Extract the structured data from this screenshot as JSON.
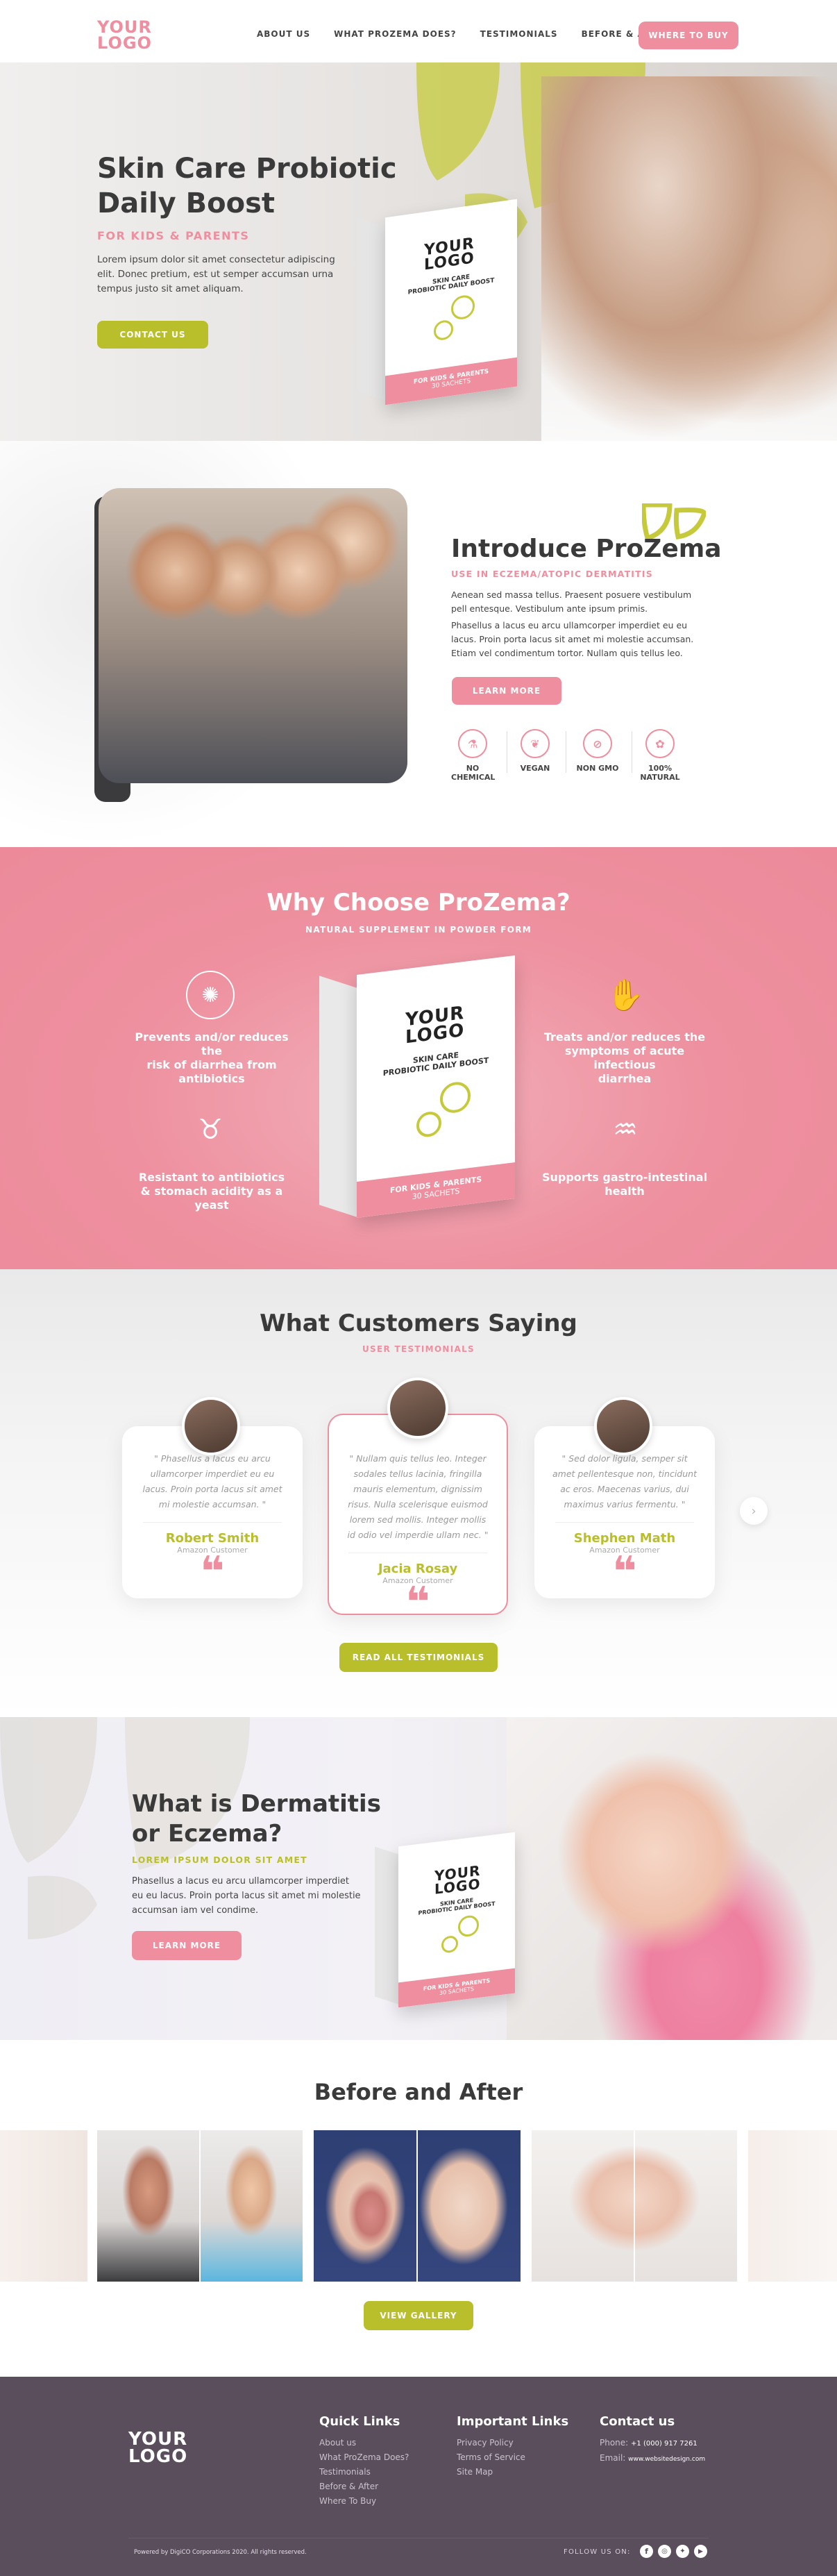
{
  "header": {
    "logo_line1": "YOUR",
    "logo_line2": "LOGO",
    "nav": [
      "ABOUT US",
      "WHAT PROZEMA DOES?",
      "TESTIMONIALS",
      "BEFORE & AFTER"
    ],
    "cta": "WHERE TO BUY"
  },
  "hero": {
    "title_line1": "Skin Care Probiotic",
    "title_line2": "Daily Boost",
    "subtitle": "FOR KIDS & PARENTS",
    "body": "Lorem ipsum dolor sit amet consectetur adipiscing elit. Donec pretium, est ut semper accumsan urna tempus justo sit amet aliquam.",
    "button": "CONTACT US"
  },
  "box": {
    "logo_line1": "YOUR",
    "logo_line2": "LOGO",
    "tagline_line1": "SKIN CARE",
    "tagline_line2": "PROBIOTIC DAILY BOOST",
    "band_line1": "FOR KIDS & PARENTS",
    "band_line2": "30 SACHETS"
  },
  "introduce": {
    "title": "Introduce ProZema",
    "subtitle": "USE IN ECZEMA/ATOPIC DERMATITIS",
    "para1": "Aenean sed massa tellus. Praesent posuere vestibulum pell entesque. Vestibulum ante ipsum primis.",
    "para2": "Phasellus a lacus eu arcu ullamcorper imperdiet eu eu lacus. Proin porta lacus sit amet mi molestie accumsan. Etiam vel condimentum tortor. Nullam quis tellus leo.",
    "button": "LEARN MORE",
    "badges": [
      {
        "line1": "NO",
        "line2": "CHEMICAL",
        "icon": "flask-icon"
      },
      {
        "line1": "VEGAN",
        "line2": "",
        "icon": "leaf-icon"
      },
      {
        "line1": "NON GMO",
        "line2": "",
        "icon": "non-gmo-icon"
      },
      {
        "line1": "100%",
        "line2": "NATURAL",
        "icon": "natural-leaf-icon"
      }
    ]
  },
  "why": {
    "title": "Why Choose ProZema?",
    "subtitle": "NATURAL SUPPLEMENT IN POWDER FORM",
    "benefits": [
      {
        "line1": "Prevents and/or reduces the",
        "line2": "risk of diarrhea from",
        "line3": "antibiotics",
        "icon": "bacteria-icon"
      },
      {
        "line1": "Treats and/or reduces the",
        "line2": "symptoms of acute infectious",
        "line3": "diarrhea",
        "icon": "hand-virus-icon"
      },
      {
        "line1": "Resistant to antibiotics",
        "line2": "& stomach acidity as a yeast",
        "line3": "",
        "icon": "stomach-icon"
      },
      {
        "line1": "Supports gastro-intestinal",
        "line2": "health",
        "line3": "",
        "icon": "gut-icon"
      }
    ]
  },
  "testimonials": {
    "title": "What Customers Saying",
    "subtitle": "USER TESTIMONIALS",
    "cards": [
      {
        "quote": "\" Phasellus a lacus eu arcu ullamcorper imperdiet eu eu lacus. Proin porta lacus sit amet mi molestie accumsan. \"",
        "name": "Robert Smith",
        "role": "Amazon Customer"
      },
      {
        "quote": "\" Nullam quis tellus leo. Integer sodales tellus lacinia, fringilla mauris elementum, dignissim risus. Nulla scelerisque euismod lorem sed mollis. Integer mollis id odio vel imperdie ullam nec. \"",
        "name": "Jacia Rosay",
        "role": "Amazon Customer"
      },
      {
        "quote": "\" Sed dolor ligula, semper sit amet pellentesque non, tincidunt ac eros. Maecenas varius, dui maximus varius fermentu. \"",
        "name": "Shephen Math",
        "role": "Amazon Customer"
      }
    ],
    "button": "READ ALL TESTIMONIALS"
  },
  "dermatitis": {
    "title_line1": "What is Dermatitis",
    "title_line2": "or Eczema?",
    "subtitle": "LOREM IPSUM DOLOR SIT AMET",
    "body": "Phasellus a lacus eu arcu ullamcorper imperdiet eu eu lacus. Proin porta lacus sit amet mi molestie accumsan iam vel condime.",
    "button": "LEARN MORE"
  },
  "before_after": {
    "title": "Before and After",
    "button": "VIEW GALLERY"
  },
  "footer": {
    "logo_line1": "YOUR",
    "logo_line2": "LOGO",
    "quick_title": "Quick Links",
    "quick_links": [
      "About us",
      "What ProZema Does?",
      "Testimonials",
      "Before & After",
      "Where To Buy"
    ],
    "important_title": "Important Links",
    "important_links": [
      "Privacy Policy",
      "Terms of Service",
      "Site Map"
    ],
    "contact_title": "Contact us",
    "phone_label": "Phone:",
    "phone": "+1 (000) 917 7261",
    "email_label": "Email:",
    "email": "www.websitedesign.com",
    "copyright": "Powered by DigiCO Corporations 2020. All rights reserved.",
    "follow": "FOLLOW US ON:",
    "socials": [
      "facebook-icon",
      "instagram-icon",
      "twitter-icon",
      "youtube-icon"
    ]
  },
  "colors": {
    "pink": "#ee8e9e",
    "green": "#b9bf2b",
    "footer": "#5a4e5c"
  }
}
